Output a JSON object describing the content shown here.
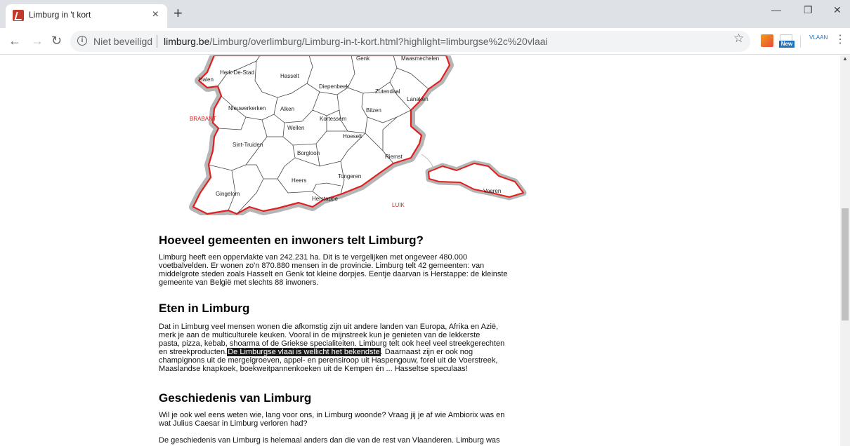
{
  "browser": {
    "tab_title": "Limburg in 't kort",
    "tab_close": "×",
    "new_tab": "+",
    "security_label": "Niet beveiligd",
    "url_host": "limburg.be",
    "url_path": "/Limburg/overlimburg/Limburg-in-t-kort.html?highlight=limburgse%2c%20vlaai",
    "extension_new_badge": "New",
    "extension_label": "VLAAN"
  },
  "map": {
    "regions": [
      "Halen",
      "Herk-De-Stad",
      "Hasselt",
      "Genk",
      "Maasmechelen",
      "Diepenbeek",
      "Zutendaal",
      "Lanaken",
      "Nieuwerkerken",
      "Alken",
      "Kortessem",
      "Bilzen",
      "Wellen",
      "Hoeselt",
      "Sint-Truiden",
      "Borgloon",
      "Riemst",
      "Tongeren",
      "Heers",
      "Gingelom",
      "Herstappe",
      "Voeren"
    ],
    "neighbors": [
      "BRABANT",
      "LUIK"
    ],
    "colors": {
      "border": "#e02020",
      "outline": "#9e9e9e",
      "neighbor_text": "#e02020"
    }
  },
  "content": {
    "section1": {
      "heading": "Hoeveel gemeenten en inwoners telt Limburg?",
      "lines": [
        "Limburg heeft een oppervlakte van 242.231 ha. Dit is te vergelijken met ongeveer 480.000",
        "voetbalvelden. Er wonen zo'n 870.880 mensen in de provincie. Limburg telt 42 gemeenten: van",
        "middelgrote steden zoals Hasselt en Genk tot kleine dorpjes. Eentje daarvan is Herstappe: de kleinste",
        "gemeente van België met slechts 88 inwoners."
      ]
    },
    "section2": {
      "heading": "Eten in Limburg",
      "lines": [
        "Dat in Limburg veel mensen wonen die afkomstig zijn uit andere landen van Europa, Afrika en Azië,",
        "merk je aan de multiculturele keuken. Vooral in de mijnstreek kun je genieten van de lekkerste",
        "pasta, pizza, kebab, shoarma of de Griekse specialiteiten. Limburg telt ook heel veel streekgerechten"
      ],
      "line4_before": "en streekproducten.",
      "line4_highlight": "De Limburgse vlaai is wellicht het bekendste",
      "line4_after": ". Daarnaast zijn er ook nog",
      "lines_after": [
        "champignons uit de mergelgroeven, appel- en perensiroop uit Haspengouw, forel uit de Voerstreek,",
        "Maaslandse knapkoek, boekweitpannenkoeken uit de Kempen én ... Hasseltse speculaas!"
      ]
    },
    "section3": {
      "heading": "Geschiedenis van Limburg",
      "lines": [
        "Wil je ook wel eens weten wie, lang voor ons, in Limburg woonde? Vraag jij je af wie Ambiorix was en",
        "wat Julius Caesar in Limburg verloren had?"
      ],
      "para2": "De geschiedenis van Limburg is helemaal anders dan die van de rest van Vlaanderen. Limburg was"
    }
  }
}
